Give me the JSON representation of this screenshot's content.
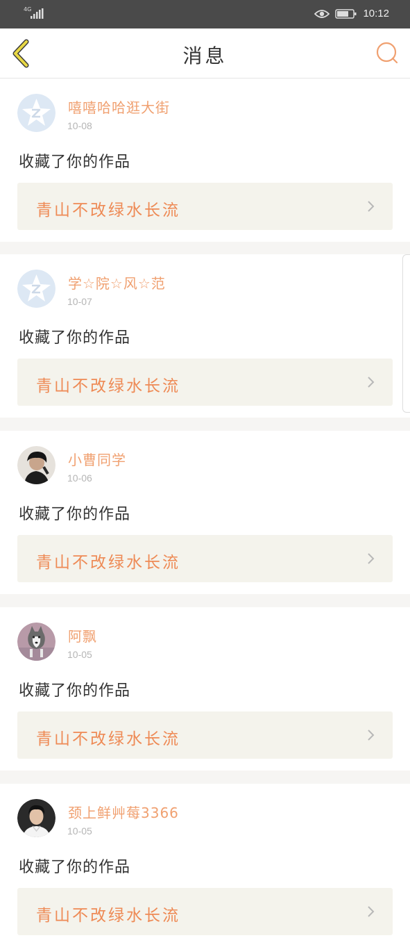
{
  "status_bar": {
    "network": "4G",
    "time": "10:12"
  },
  "header": {
    "title": "消息"
  },
  "notifications": [
    {
      "username": "嘻嘻哈哈逛大街",
      "date": "10-08",
      "action": "收藏了你的作品",
      "work_title": "青山不改绿水长流",
      "avatar": "default-avatar"
    },
    {
      "username": "学☆院☆风☆范",
      "date": "10-07",
      "action": "收藏了你的作品",
      "work_title": "青山不改绿水长流",
      "avatar": "default-avatar"
    },
    {
      "username": "小曹同学",
      "date": "10-06",
      "action": "收藏了你的作品",
      "work_title": "青山不改绿水长流",
      "avatar": "photo-avatar-person"
    },
    {
      "username": "阿飘",
      "date": "10-05",
      "action": "收藏了你的作品",
      "work_title": "青山不改绿水长流",
      "avatar": "photo-avatar-dog"
    },
    {
      "username": "颈上鲜艸莓3366",
      "date": "10-05",
      "action": "收藏了你的作品",
      "work_title": "青山不改绿水长流",
      "avatar": "photo-avatar-person"
    }
  ],
  "colors": {
    "accent": "#ee8a55",
    "username": "#f0a070",
    "back_arrow": "#e8d845",
    "card_bg": "#f4f3ec"
  }
}
